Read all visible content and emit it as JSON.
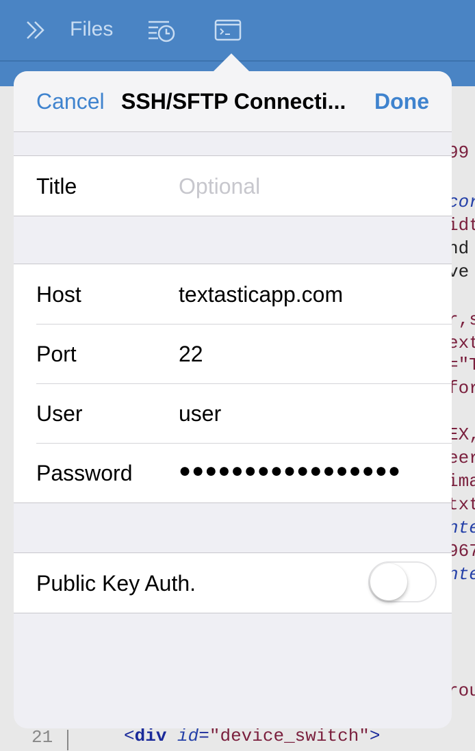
{
  "toolbar": {
    "files_label": "Files",
    "icons": [
      "double-chevron-icon",
      "history-list-icon",
      "terminal-icon"
    ]
  },
  "dialog": {
    "cancel_label": "Cancel",
    "title": "SSH/SFTP Connecti...",
    "done_label": "Done",
    "title_row": {
      "label": "Title",
      "placeholder": "Optional"
    },
    "connection_rows": [
      {
        "label": "Host",
        "value": "textasticapp.com"
      },
      {
        "label": "Port",
        "value": "22"
      },
      {
        "label": "User",
        "value": "user"
      },
      {
        "label": "Password",
        "value": "●●●●●●●●●●●●●●●●●"
      }
    ],
    "public_key_row": {
      "label": "Public Key Auth.",
      "enabled": false
    }
  },
  "editor": {
    "fragments": [
      "99",
      "cor",
      "idt",
      "nd",
      "ve",
      "r,s",
      "ext",
      "=\"T",
      "for",
      "EX,",
      "eer",
      "ima",
      "txt",
      "nte",
      "967",
      "nte",
      "rou"
    ],
    "line_number": "21",
    "code_tag_open": "<",
    "code_tag_name": "div",
    "code_attr": "id",
    "code_eq": "=",
    "code_value": "\"device_switch\"",
    "code_tag_close": ">"
  },
  "colors": {
    "accent": "#3f83ce",
    "toolbar": "#4a84c4",
    "background": "#efeff4"
  }
}
